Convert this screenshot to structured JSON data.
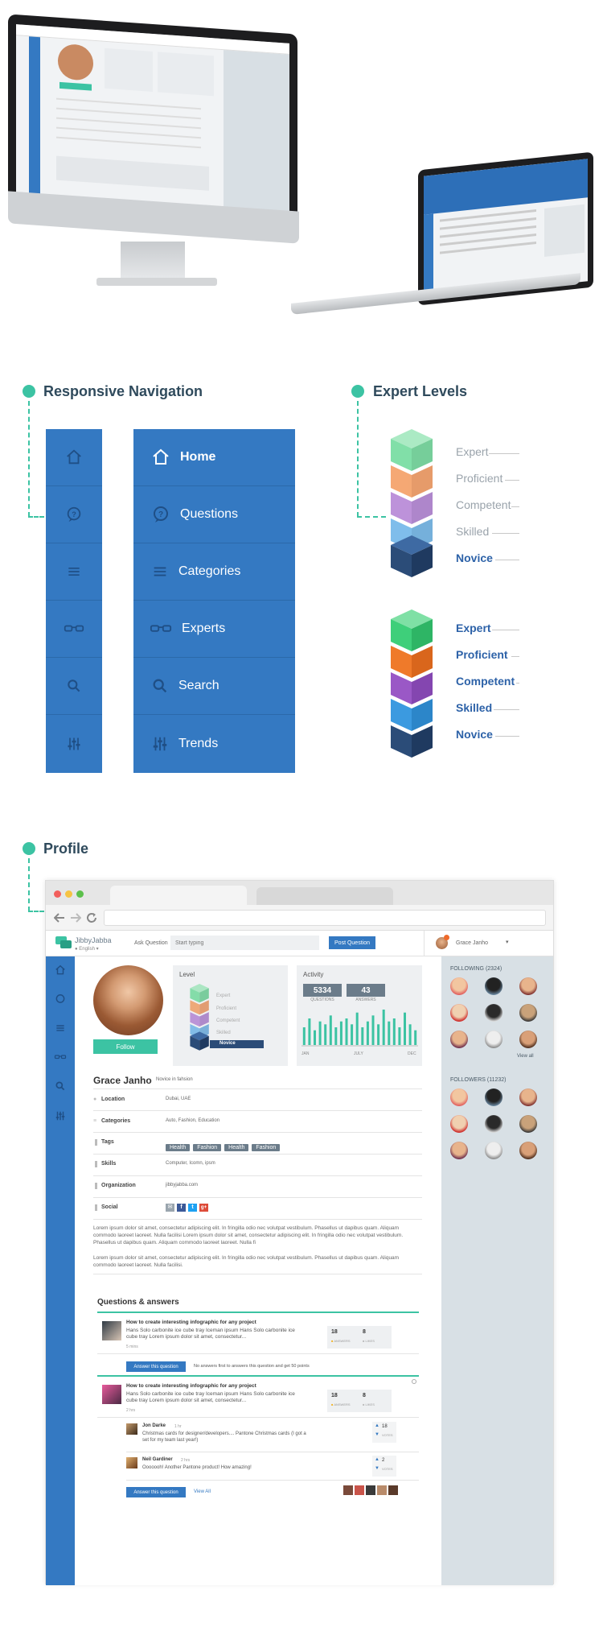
{
  "sections": {
    "nav_title": "Responsive Navigation",
    "levels_title": "Expert Levels",
    "profile_title": "Profile"
  },
  "nav": {
    "items": [
      {
        "label": "Home",
        "icon": "home-icon"
      },
      {
        "label": "Questions",
        "icon": "question-bubble-icon"
      },
      {
        "label": "Categories",
        "icon": "menu-lines-icon"
      },
      {
        "label": "Experts",
        "icon": "glasses-icon"
      },
      {
        "label": "Search",
        "icon": "search-icon"
      },
      {
        "label": "Trends",
        "icon": "sliders-icon"
      }
    ]
  },
  "levels": {
    "labels": [
      "Expert",
      "Proficient",
      "Competent",
      "Skilled",
      "Novice"
    ],
    "active_label": "Novice"
  },
  "colors": {
    "brand_blue": "#3479c2",
    "teal": "#3cc3a3",
    "expert": "#3ecf7a",
    "proficient": "#ef7a2a",
    "competent": "#9a58c6",
    "skilled": "#3b9ae0",
    "novice": "#2b4c78"
  },
  "app": {
    "brand": "JibbyJabba",
    "language": "English",
    "ask_label": "Ask Question",
    "ask_placeholder": "Start typing",
    "post_button": "Post Question",
    "user_name": "Grace Janho"
  },
  "profile": {
    "name": "Grace Janho",
    "subtitle": "Novice in fahsion",
    "follow": "Follow",
    "level_title": "Level",
    "activity_title": "Activity",
    "questions_count": "5334",
    "questions_label": "QUESTIONS",
    "answers_count": "43",
    "answers_label": "ANSWERS",
    "activity_months": [
      "JAN",
      "JULY",
      "DEC"
    ],
    "activity_bars": [
      6,
      9,
      5,
      8,
      7,
      10,
      6,
      8,
      9,
      7,
      11,
      6,
      8,
      10,
      7,
      12,
      8,
      9,
      6,
      11,
      7,
      5
    ],
    "fields": [
      {
        "label": "Location",
        "value": "Dubai, UAE",
        "icon": "location-pin-icon"
      },
      {
        "label": "Categories",
        "value": "Auto, Fashion, Education",
        "icon": "list-icon"
      },
      {
        "label": "Tags",
        "value": "",
        "icon": "tag-icon"
      },
      {
        "label": "Skills",
        "value": "Computer, Icomn, ipsm",
        "icon": "tag-icon"
      },
      {
        "label": "Organization",
        "value": "jibbyjabba.com",
        "icon": "tag-icon"
      },
      {
        "label": "Social",
        "value": "",
        "icon": "tag-icon"
      }
    ],
    "tags": [
      "Health",
      "Fashion",
      "Health",
      "Fashion"
    ],
    "bio": [
      "Lorem ipsum dolor sit amet, consectetur adipiscing elit. In fringilla odio nec volutpat vestibulum. Phasellus ut dapibus quam. Aliquam commodo laoreet laoreet. Nulla facilisi Lorem ipsum dolor sit amet, consectetur adipiscing elit. In fringilla odio nec volutpat vestibulum. Phasellus ut dapibus quam. Aliquam commodo laoreet laoreet. Nulla fi",
      "Lorem ipsum dolor sit amet, consectetur adipiscing elit. In fringilla odio nec volutpat vestibulum. Phasellus ut dapibus quam. Aliquam commodo laoreet laoreet. Nulla facilisi."
    ]
  },
  "sidebar": {
    "following_title": "FOLLOWING (2324)",
    "followers_title": "FOLLOWERS (11232)",
    "view_all": "View all"
  },
  "qa": {
    "title": "Questions & answers",
    "items": [
      {
        "question": "How to create interesting infographic for any project",
        "body": "Hans Solo carbonite ice cube tray Iceman ipsum Hans Solo carbonite ice cube tray Lorem ipsum dolor sit amet, consectetur...",
        "time": "5 mins",
        "answers": "18",
        "answers_label": "ANSWERS",
        "likes": "8",
        "likes_label": "LIKES",
        "answer_btn": "Answer this question",
        "note": "No answers first to answers this question and get 50 points"
      },
      {
        "question": "How to create interesting infographic for any project",
        "body": "Hans Solo carbonite ice cube tray Iceman ipsum Hans Solo carbonite ice cube tray Lorem ipsum dolor sit amet, consectetur...",
        "time": "2 hrs",
        "answers": "18",
        "answers_label": "ANSWERS",
        "likes": "8",
        "likes_label": "LIKES",
        "answer_btn": "Answer this question",
        "view_all": "View All",
        "replies": [
          {
            "name": "Jon Darke",
            "time": "1 hr",
            "text": "Christmas cards for designer/developers.... Pantone Christmas cards (I got a set for my team last year!)",
            "votes": "18",
            "votes_label": "VOTES"
          },
          {
            "name": "Neil Gardiner",
            "time": "2 hrs",
            "text": "Ooooooh! Another Pantone product! How amazing!",
            "votes": "2",
            "votes_label": "VOTES"
          }
        ]
      }
    ]
  }
}
